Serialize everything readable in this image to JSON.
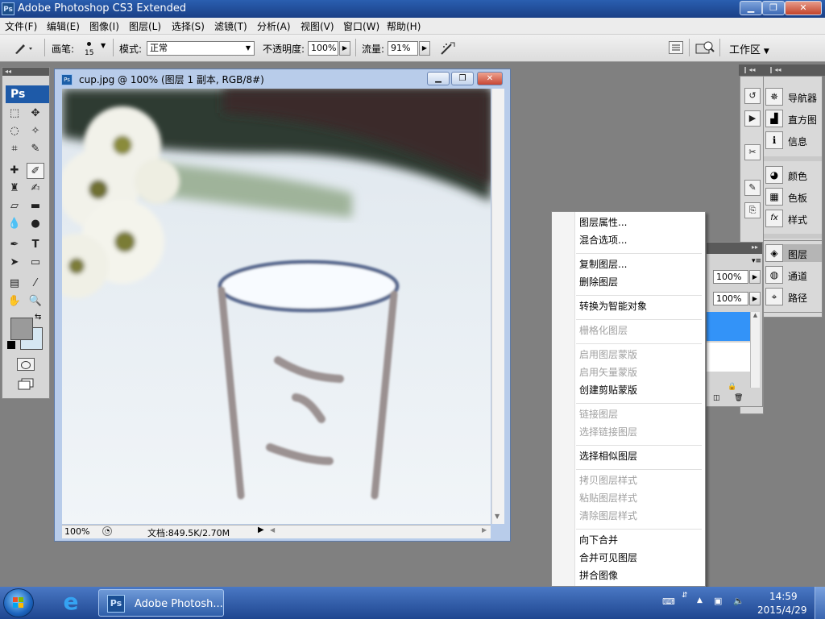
{
  "app": {
    "title": "Adobe Photoshop CS3 Extended",
    "logo_text": "Ps"
  },
  "menubar": {
    "items": [
      "文件(F)",
      "编辑(E)",
      "图像(I)",
      "图层(L)",
      "选择(S)",
      "滤镜(T)",
      "分析(A)",
      "视图(V)",
      "窗口(W)",
      "帮助(H)"
    ]
  },
  "optionsbar": {
    "brush_label": "画笔:",
    "brush_size": "15",
    "mode_label": "模式:",
    "mode_value": "正常",
    "opacity_label": "不透明度:",
    "opacity_value": "100%",
    "flow_label": "流量:",
    "flow_value": "91%",
    "workspace_label": "工作区"
  },
  "tools": {
    "logo": "Ps"
  },
  "document": {
    "title": "cup.jpg @ 100% (图层 1 副本, RGB/8#)",
    "icon_text": "Ps",
    "zoom": "100%",
    "doc_info": "文档:849.5K/2.70M"
  },
  "panels": {
    "group1": [
      "导航器",
      "直方图",
      "信息"
    ],
    "group2": [
      "颜色",
      "色板",
      "样式"
    ],
    "group3": [
      "图层",
      "通道",
      "路径"
    ]
  },
  "layers_panel": {
    "opacity_value": "100%",
    "fill_value": "100%"
  },
  "context_menu": {
    "groups": [
      [
        {
          "label": "图层属性...",
          "enabled": true
        },
        {
          "label": "混合选项...",
          "enabled": true
        }
      ],
      [
        {
          "label": "复制图层...",
          "enabled": true
        },
        {
          "label": "删除图层",
          "enabled": true
        }
      ],
      [
        {
          "label": "转换为智能对象",
          "enabled": true
        }
      ],
      [
        {
          "label": "栅格化图层",
          "enabled": false
        }
      ],
      [
        {
          "label": "启用图层蒙版",
          "enabled": false
        },
        {
          "label": "启用矢量蒙版",
          "enabled": false
        },
        {
          "label": "创建剪贴蒙版",
          "enabled": true
        }
      ],
      [
        {
          "label": "链接图层",
          "enabled": false
        },
        {
          "label": "选择链接图层",
          "enabled": false
        }
      ],
      [
        {
          "label": "选择相似图层",
          "enabled": true
        }
      ],
      [
        {
          "label": "拷贝图层样式",
          "enabled": false
        },
        {
          "label": "粘贴图层样式",
          "enabled": false
        },
        {
          "label": "清除图层样式",
          "enabled": false
        }
      ],
      [
        {
          "label": "向下合并",
          "enabled": true
        },
        {
          "label": "合并可见图层",
          "enabled": true
        },
        {
          "label": "拼合图像",
          "enabled": true
        }
      ]
    ]
  },
  "taskbar": {
    "task_label": "Adobe Photosh...",
    "task_icon_text": "Ps",
    "ie_glyph": "e",
    "time": "14:59",
    "date": "2015/4/29"
  }
}
